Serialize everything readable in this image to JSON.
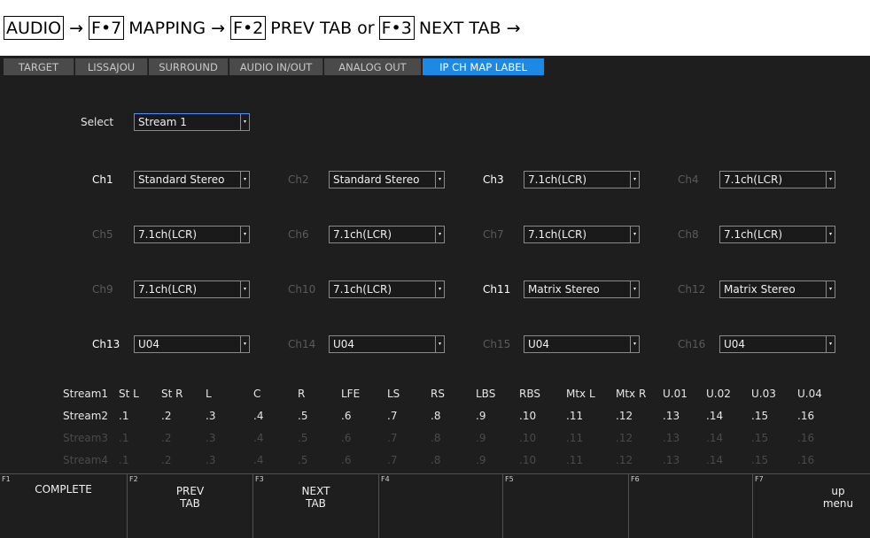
{
  "caption": {
    "key1": "AUDIO",
    "key2": "F•7",
    "text2": "MAPPING",
    "key3": "F•2",
    "text3": "PREV TAB or",
    "key4": "F•3",
    "text4": "NEXT TAB",
    "arrow": "→"
  },
  "tabs": [
    {
      "label": "TARGET"
    },
    {
      "label": "LISSAJOU"
    },
    {
      "label": "SURROUND"
    },
    {
      "label": "AUDIO IN/OUT"
    },
    {
      "label": "ANALOG OUT"
    },
    {
      "label": "IP CH MAP LABEL",
      "active": true
    }
  ],
  "select_row": {
    "label": "Select",
    "value": "Stream 1"
  },
  "channels": [
    {
      "label": "Ch1",
      "value": "Standard Stereo"
    },
    {
      "label": "Ch2",
      "value": "Standard Stereo"
    },
    {
      "label": "Ch3",
      "value": "7.1ch(LCR)"
    },
    {
      "label": "Ch4",
      "value": "7.1ch(LCR)"
    },
    {
      "label": "Ch5",
      "value": "7.1ch(LCR)"
    },
    {
      "label": "Ch6",
      "value": "7.1ch(LCR)"
    },
    {
      "label": "Ch7",
      "value": "7.1ch(LCR)"
    },
    {
      "label": "Ch8",
      "value": "7.1ch(LCR)"
    },
    {
      "label": "Ch9",
      "value": "7.1ch(LCR)"
    },
    {
      "label": "Ch10",
      "value": "7.1ch(LCR)"
    },
    {
      "label": "Ch11",
      "value": "Matrix Stereo"
    },
    {
      "label": "Ch12",
      "value": "Matrix Stereo"
    },
    {
      "label": "Ch13",
      "value": "U04"
    },
    {
      "label": "Ch14",
      "value": "U04"
    },
    {
      "label": "Ch15",
      "value": "U04"
    },
    {
      "label": "Ch16",
      "value": "U04"
    }
  ],
  "dropdown_arrow": "▾",
  "stream_table": {
    "rows": [
      {
        "name": "Stream1",
        "cells": [
          "St L",
          "St R",
          "L",
          "C",
          "R",
          "LFE",
          "LS",
          "RS",
          "LBS",
          "RBS",
          "Mtx L",
          "Mtx R",
          "U.01",
          "U.02",
          "U.03",
          "U.04"
        ]
      },
      {
        "name": "Stream2",
        "cells": [
          ".1",
          ".2",
          ".3",
          ".4",
          ".5",
          ".6",
          ".7",
          ".8",
          ".9",
          ".10",
          ".11",
          ".12",
          ".13",
          ".14",
          ".15",
          ".16"
        ]
      },
      {
        "name": "Stream3",
        "cells": [
          ".1",
          ".2",
          ".3",
          ".4",
          ".5",
          ".6",
          ".7",
          ".8",
          ".9",
          ".10",
          ".11",
          ".12",
          ".13",
          ".14",
          ".15",
          ".16"
        ]
      },
      {
        "name": "Stream4",
        "cells": [
          ".1",
          ".2",
          ".3",
          ".4",
          ".5",
          ".6",
          ".7",
          ".8",
          ".9",
          ".10",
          ".11",
          ".12",
          ".13",
          ".14",
          ".15",
          ".16"
        ]
      }
    ]
  },
  "function_keys": [
    {
      "num": "F1",
      "label": "COMPLETE"
    },
    {
      "num": "F2",
      "label": "PREV\nTAB"
    },
    {
      "num": "F3",
      "label": "NEXT\nTAB"
    },
    {
      "num": "F4",
      "label": ""
    },
    {
      "num": "F5",
      "label": ""
    },
    {
      "num": "F6",
      "label": ""
    },
    {
      "num": "F7",
      "label": "up\nmenu"
    }
  ]
}
